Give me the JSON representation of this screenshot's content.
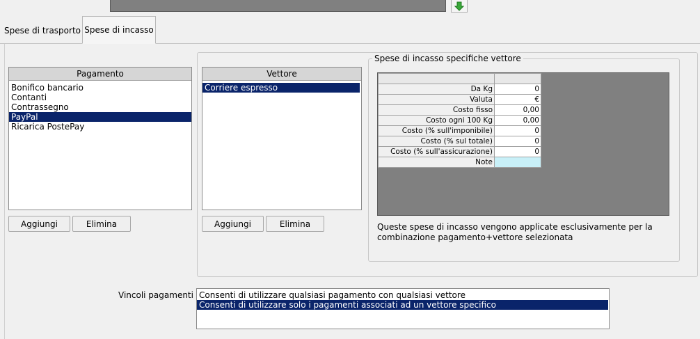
{
  "top_arrow": "⇩",
  "tabs": {
    "transport": "Spese di trasporto",
    "collection": "Spese di incasso"
  },
  "payment": {
    "header": "Pagamento",
    "items": [
      "Bonifico bancario",
      "Contanti",
      "Contrassegno",
      "PayPal",
      "Ricarica PostePay"
    ],
    "selected_index": 3,
    "add_label": "Aggiungi",
    "delete_label": "Elimina"
  },
  "carrier": {
    "header": "Vettore",
    "items": [
      "Corriere espresso"
    ],
    "selected_index": 0,
    "add_label": "Aggiungi",
    "delete_label": "Elimina"
  },
  "specific": {
    "legend": "Spese di incasso specifiche vettore",
    "rows": [
      {
        "label": "Da Kg",
        "value": "0"
      },
      {
        "label": "Valuta",
        "value": "€"
      },
      {
        "label": "Costo fisso",
        "value": "0,00"
      },
      {
        "label": "Costo ogni 100 Kg",
        "value": "0,00"
      },
      {
        "label": "Costo (% sull'imponibile)",
        "value": "0"
      },
      {
        "label": "Costo (% sul totale)",
        "value": "0"
      },
      {
        "label": "Costo (% sull'assicurazione)",
        "value": "0"
      },
      {
        "label": "Note",
        "value": ""
      }
    ],
    "note_line1": "Queste spese di incasso vengono applicate esclusivamente per la",
    "note_line2": "combinazione pagamento+vettore selezionata"
  },
  "constraints": {
    "label": "Vincoli pagamenti :",
    "options": [
      "Consenti di utilizzare qualsiasi pagamento con qualsiasi vettore",
      "Consenti di utilizzare solo i pagamenti associati ad un vettore specifico"
    ],
    "selected_index": 1
  },
  "colors": {
    "selection": "#0a246a",
    "grid_background": "#808080",
    "note_cell": "#c8f0f8",
    "arrow": "#3aa83a"
  }
}
